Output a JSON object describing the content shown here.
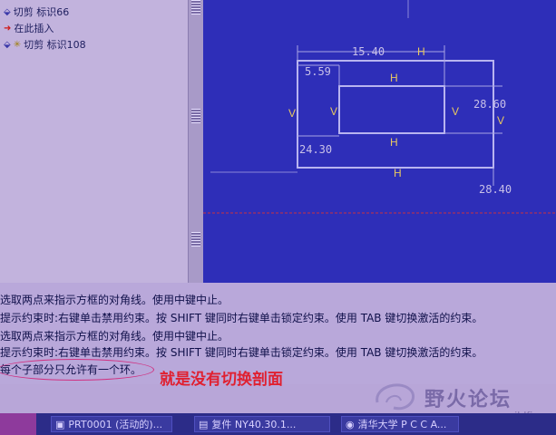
{
  "tree": {
    "items": [
      {
        "icon": "cut-icon",
        "label": "切剪 标识66"
      },
      {
        "icon": "insert-arrow-icon",
        "label": "在此插入"
      },
      {
        "icon": "cut-feature-icon",
        "label": "切剪 标识108"
      }
    ]
  },
  "sketch": {
    "dims": [
      "15.40",
      "5.59",
      "28.60",
      "24.30",
      "28.40"
    ],
    "constraints": {
      "h": "H",
      "v": "V"
    }
  },
  "messages": [
    "选取两点来指示方框的对角线。使用中键中止。",
    "提示约束时:右键单击禁用约束。按 SHIFT 键同时右键单击锁定约束。使用 TAB 键切换激活的约束。",
    "选取两点来指示方框的对角线。使用中键中止。",
    "提示约束时:右键单击禁用约束。按 SHIFT 键同时右键单击锁定约束。使用 TAB 键切换激活的约束。",
    "每个子部分只允许有一个环。"
  ],
  "annotation": "就是没有切换剖面",
  "logo": {
    "text": "野火论坛",
    "url": "www.proewildfire.cn"
  },
  "taskbar": {
    "items": [
      "PRT0001 (活动的)...",
      "复件 NY40.30.1...",
      "清华大学 P C C A..."
    ]
  },
  "colors": {
    "canvas": "#2e2eb8",
    "callout": "#e02030",
    "hv": "#e8c860"
  }
}
